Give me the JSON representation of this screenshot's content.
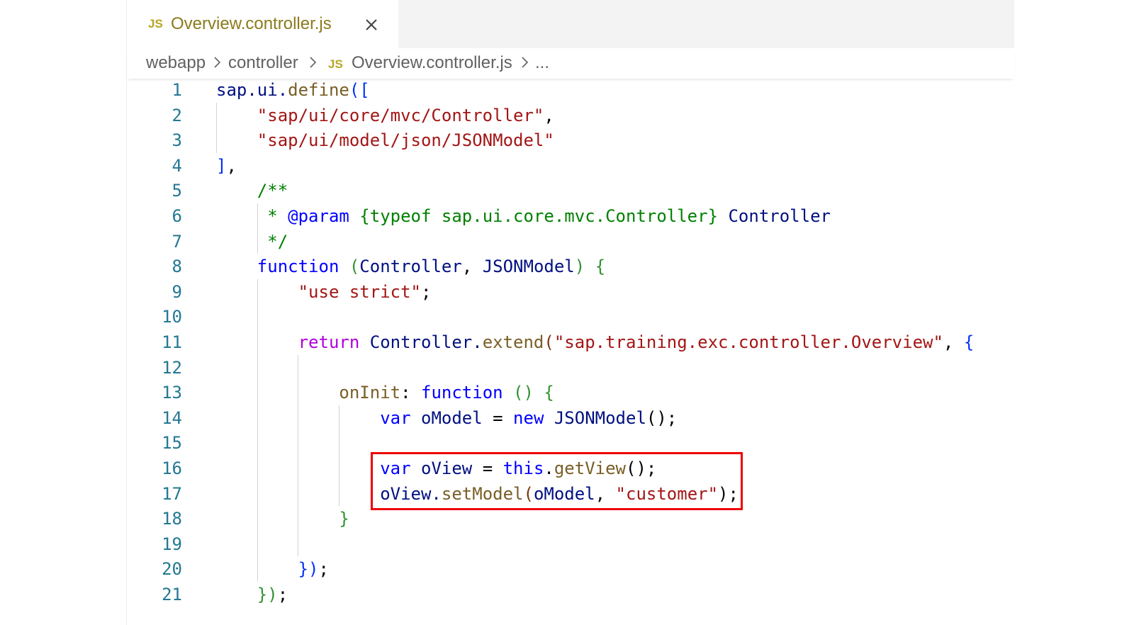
{
  "tab": {
    "badge": "JS",
    "title": "Overview.controller.js",
    "close_icon": "close-icon"
  },
  "breadcrumb": {
    "items": [
      "webapp",
      "controller",
      "Overview.controller.js",
      "..."
    ],
    "file_badge": "JS",
    "separator_icon": "chevron-right-icon"
  },
  "editor": {
    "line_numbers": [
      "1",
      "2",
      "3",
      "4",
      "5",
      "6",
      "7",
      "8",
      "9",
      "10",
      "11",
      "12",
      "13",
      "14",
      "15",
      "16",
      "17",
      "18",
      "19",
      "20",
      "21"
    ],
    "highlight_color": "#ee0000",
    "highlighted_lines": [
      "16",
      "17"
    ],
    "lines": [
      [
        {
          "t": "sap.ui.",
          "c": "plain"
        },
        {
          "t": "define",
          "c": "fn"
        },
        {
          "t": "([",
          "c": "br1"
        }
      ],
      [
        {
          "t": "    ",
          "c": "plain"
        },
        {
          "t": "\"sap/ui/core/mvc/Controller\"",
          "c": "str"
        },
        {
          "t": ",",
          "c": "pun"
        }
      ],
      [
        {
          "t": "    ",
          "c": "plain"
        },
        {
          "t": "\"sap/ui/model/json/JSONModel\"",
          "c": "str"
        }
      ],
      [
        {
          "t": "]",
          "c": "br1"
        },
        {
          "t": ",",
          "c": "pun"
        }
      ],
      [
        {
          "t": "    ",
          "c": "plain"
        },
        {
          "t": "/**",
          "c": "cmt"
        }
      ],
      [
        {
          "t": "     ",
          "c": "plain"
        },
        {
          "t": "* ",
          "c": "cmt"
        },
        {
          "t": "@param",
          "c": "tag"
        },
        {
          "t": " {typeof sap.ui.core.mvc.Controller}",
          "c": "cmt"
        },
        {
          "t": " Controller",
          "c": "dark"
        }
      ],
      [
        {
          "t": "     ",
          "c": "plain"
        },
        {
          "t": "*/",
          "c": "cmt"
        }
      ],
      [
        {
          "t": "    ",
          "c": "plain"
        },
        {
          "t": "function",
          "c": "kw"
        },
        {
          "t": " ",
          "c": "plain"
        },
        {
          "t": "(",
          "c": "br2"
        },
        {
          "t": "Controller",
          "c": "plain"
        },
        {
          "t": ", ",
          "c": "pun"
        },
        {
          "t": "JSONModel",
          "c": "plain"
        },
        {
          "t": ")",
          "c": "br2"
        },
        {
          "t": " ",
          "c": "plain"
        },
        {
          "t": "{",
          "c": "br2"
        }
      ],
      [
        {
          "t": "        ",
          "c": "plain"
        },
        {
          "t": "\"use strict\"",
          "c": "str"
        },
        {
          "t": ";",
          "c": "pun"
        }
      ],
      [
        {
          "t": "",
          "c": "plain"
        }
      ],
      [
        {
          "t": "        ",
          "c": "plain"
        },
        {
          "t": "return",
          "c": "ctl"
        },
        {
          "t": " Controller.",
          "c": "plain"
        },
        {
          "t": "extend",
          "c": "fn"
        },
        {
          "t": "(",
          "c": "br3"
        },
        {
          "t": "\"sap.training.exc.controller.Overview\"",
          "c": "str"
        },
        {
          "t": ", ",
          "c": "pun"
        },
        {
          "t": "{",
          "c": "br1"
        }
      ],
      [
        {
          "t": "",
          "c": "plain"
        }
      ],
      [
        {
          "t": "            ",
          "c": "plain"
        },
        {
          "t": "onInit",
          "c": "fn"
        },
        {
          "t": ": ",
          "c": "pun"
        },
        {
          "t": "function",
          "c": "kw"
        },
        {
          "t": " ",
          "c": "plain"
        },
        {
          "t": "()",
          "c": "br2"
        },
        {
          "t": " ",
          "c": "plain"
        },
        {
          "t": "{",
          "c": "br2"
        }
      ],
      [
        {
          "t": "                ",
          "c": "plain"
        },
        {
          "t": "var",
          "c": "kw"
        },
        {
          "t": " oModel ",
          "c": "plain"
        },
        {
          "t": "=",
          "c": "pun"
        },
        {
          "t": " ",
          "c": "plain"
        },
        {
          "t": "new",
          "c": "kw"
        },
        {
          "t": " JSONModel",
          "c": "plain"
        },
        {
          "t": "();",
          "c": "pun"
        }
      ],
      [
        {
          "t": "",
          "c": "plain"
        }
      ],
      [
        {
          "t": "                ",
          "c": "plain"
        },
        {
          "t": "var",
          "c": "kw"
        },
        {
          "t": " oView ",
          "c": "plain"
        },
        {
          "t": "=",
          "c": "pun"
        },
        {
          "t": " ",
          "c": "plain"
        },
        {
          "t": "this",
          "c": "kw"
        },
        {
          "t": ".",
          "c": "pun"
        },
        {
          "t": "getView",
          "c": "fn"
        },
        {
          "t": "();",
          "c": "pun"
        }
      ],
      [
        {
          "t": "                ",
          "c": "plain"
        },
        {
          "t": "oView.",
          "c": "plain"
        },
        {
          "t": "setModel",
          "c": "fn"
        },
        {
          "t": "(",
          "c": "br3"
        },
        {
          "t": "oModel",
          "c": "plain"
        },
        {
          "t": ", ",
          "c": "pun"
        },
        {
          "t": "\"customer\"",
          "c": "str"
        },
        {
          "t": ");",
          "c": "pun"
        }
      ],
      [
        {
          "t": "            ",
          "c": "plain"
        },
        {
          "t": "}",
          "c": "br2"
        }
      ],
      [
        {
          "t": "",
          "c": "plain"
        }
      ],
      [
        {
          "t": "        ",
          "c": "plain"
        },
        {
          "t": "})",
          "c": "br1"
        },
        {
          "t": ";",
          "c": "pun"
        }
      ],
      [
        {
          "t": "    ",
          "c": "plain"
        },
        {
          "t": "})",
          "c": "br2"
        },
        {
          "t": ";",
          "c": "pun"
        }
      ]
    ]
  }
}
